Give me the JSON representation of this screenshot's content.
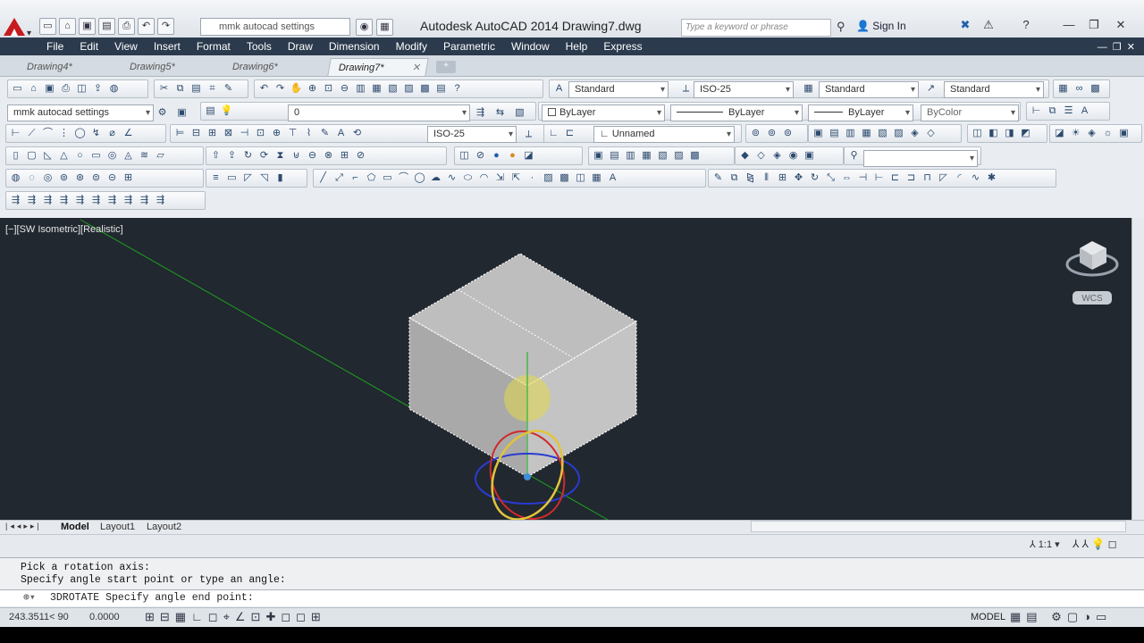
{
  "app_title": "Autodesk AutoCAD 2014    Drawing7.dwg",
  "workspace": "mmk autocad settings",
  "search_placeholder": "Type a keyword or phrase",
  "signin": "Sign In",
  "menu": [
    "File",
    "Edit",
    "View",
    "Insert",
    "Format",
    "Tools",
    "Draw",
    "Dimension",
    "Modify",
    "Parametric",
    "Window",
    "Help",
    "Express"
  ],
  "tabs": [
    "Drawing4*",
    "Drawing5*",
    "Drawing6*",
    "Drawing7*"
  ],
  "toolbar": {
    "text_style": "Standard",
    "dim_style": "ISO-25",
    "table_style": "Standard",
    "multileader_style": "Standard",
    "workspace2": "mmk autocad settings",
    "layer": "0",
    "color": "ByLayer",
    "linetype": "ByLayer",
    "lineweight": "ByLayer",
    "plotstyle": "ByColor",
    "dim_style2": "ISO-25",
    "view_name": "Unnamed"
  },
  "viewport": {
    "label": "[−][SW Isometric][Realistic]",
    "ucs": "WCS"
  },
  "layout_tabs": [
    "Model",
    "Layout1",
    "Layout2"
  ],
  "scale": "1:1",
  "command_history": [
    "Pick a rotation axis:",
    "Specify angle start point or type an angle:"
  ],
  "command_prompt": "3DROTATE Specify angle end point:",
  "status": {
    "coords": "243.3511< 90",
    "z": "0.0000",
    "model": "MODEL"
  },
  "colors": {
    "menubar": "#2b3a4d",
    "viewport": "#212830",
    "accent": "#1f5fae"
  }
}
